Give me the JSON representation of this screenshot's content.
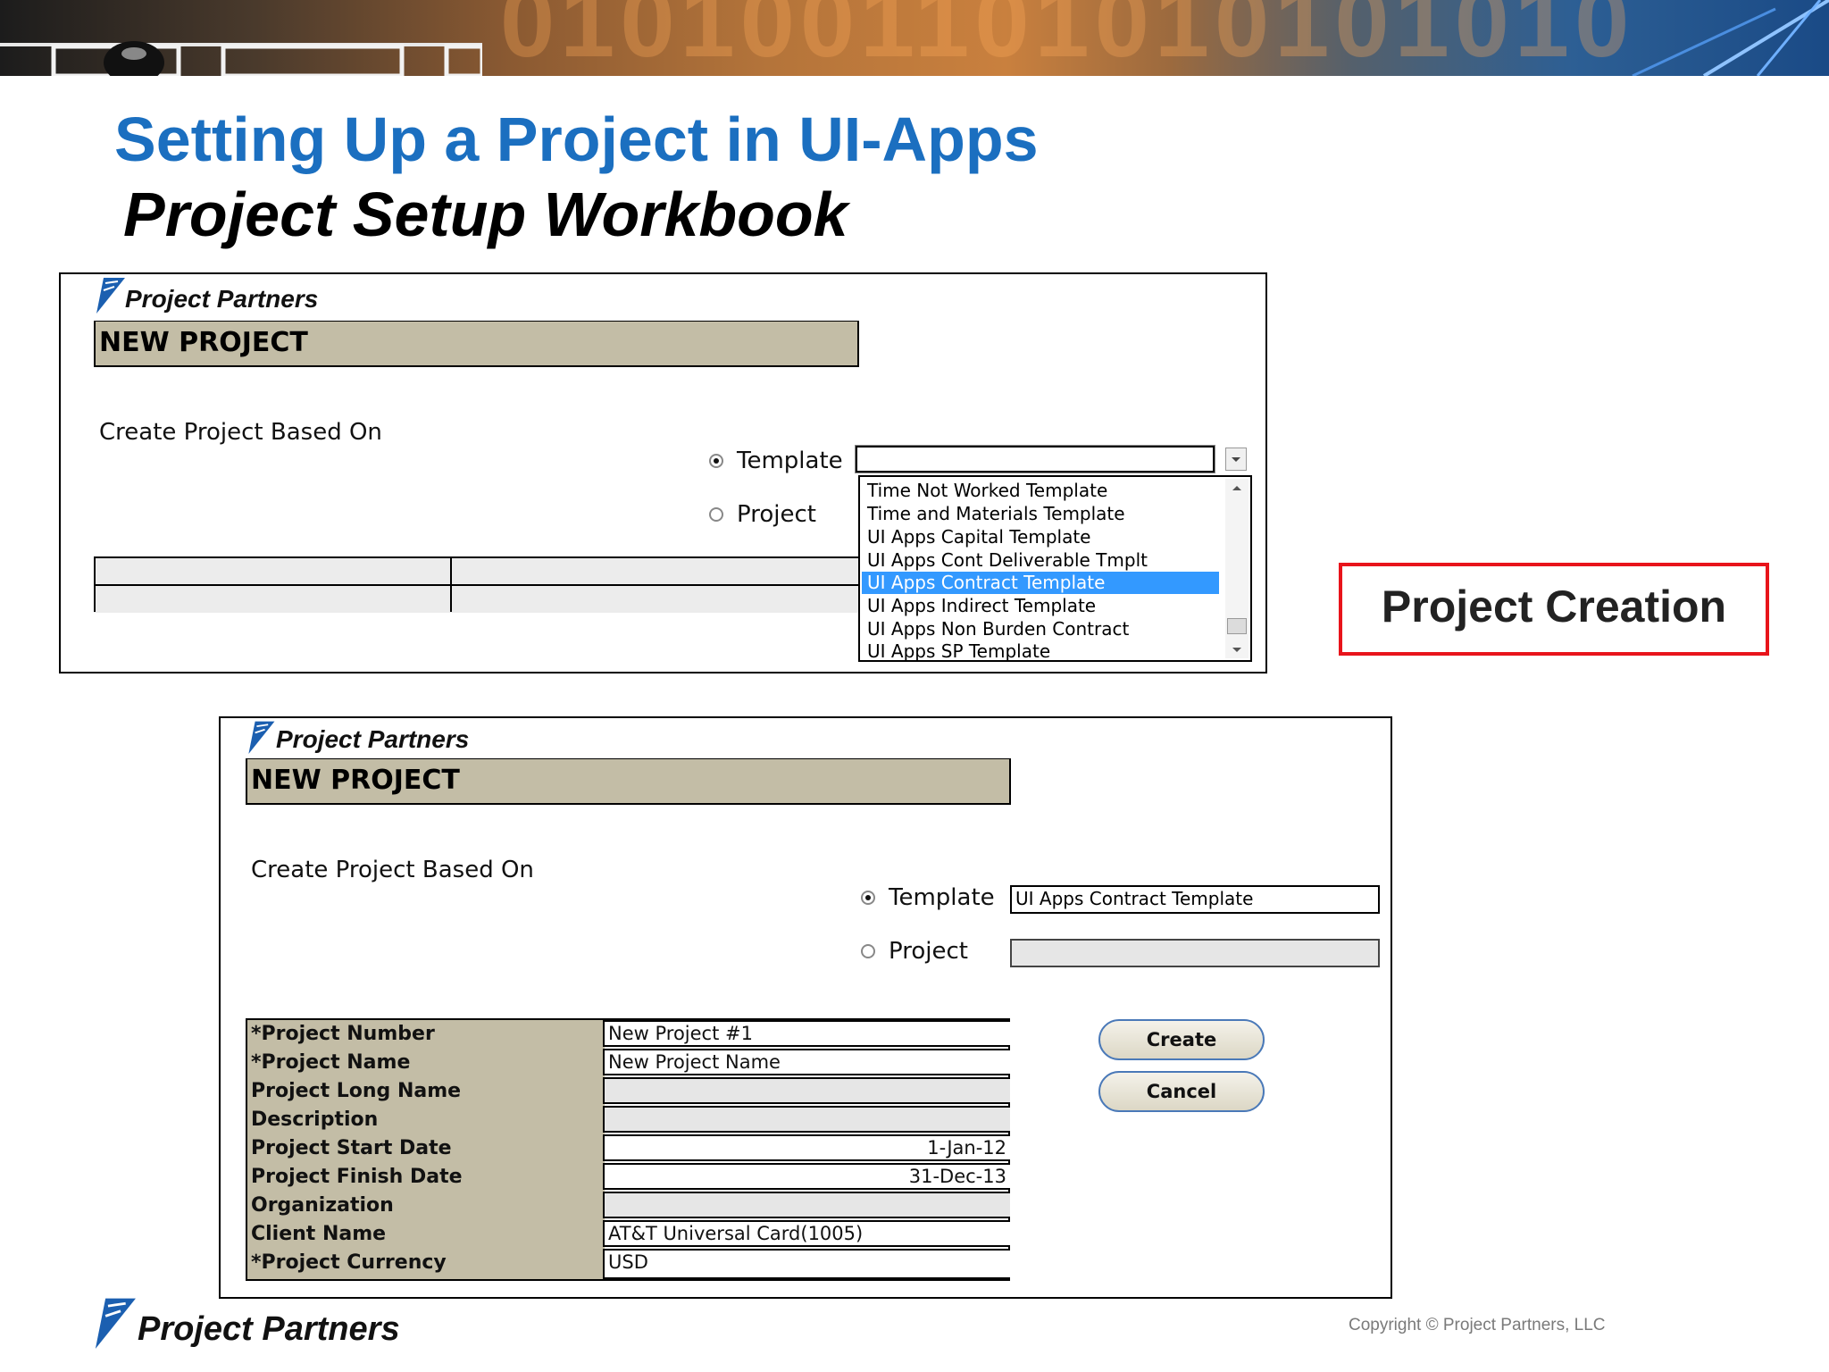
{
  "slide": {
    "title": "Setting Up a Project in UI-Apps",
    "subtitle": "Project Setup Workbook",
    "callout": "Project Creation",
    "copyright": "Copyright © Project Partners, LLC",
    "brand": "Project Partners"
  },
  "panel_top": {
    "logo": "Project Partners",
    "header": "NEW PROJECT",
    "create_label": "Create Project Based On",
    "radio_template": "Template",
    "radio_project": "Project",
    "template_selected": true,
    "dropdown_value": "",
    "dropdown_options": [
      "Time Not Worked Template",
      "Time and Materials Template",
      "UI Apps Capital Template",
      "UI Apps Cont Deliverable Tmplt",
      "UI Apps Contract Template",
      "UI Apps Indirect Template",
      "UI Apps Non Burden Contract",
      "UI Apps SP Template"
    ],
    "highlighted_option": "UI Apps Contract Template"
  },
  "panel_bottom": {
    "logo": "Project Partners",
    "header": "NEW PROJECT",
    "create_label": "Create Project Based On",
    "radio_template": "Template",
    "radio_project": "Project",
    "template_selected": true,
    "template_value": "UI Apps Contract Template",
    "project_value": "",
    "fields": [
      {
        "label": "*Project Number",
        "value": "New Project #1"
      },
      {
        "label": "*Project Name",
        "value": "New Project Name"
      },
      {
        "label": "Project Long Name",
        "value": ""
      },
      {
        "label": "Description",
        "value": ""
      },
      {
        "label": "Project Start Date",
        "value": "1-Jan-12"
      },
      {
        "label": "Project Finish Date",
        "value": "31-Dec-13"
      },
      {
        "label": "Organization",
        "value": ""
      },
      {
        "label": "Client Name",
        "value": "AT&T Universal Card(1005)"
      },
      {
        "label": "*Project Currency",
        "value": "USD"
      }
    ],
    "buttons": {
      "create": "Create",
      "cancel": "Cancel"
    }
  },
  "colors": {
    "title_blue": "#1b6fc0",
    "header_tan": "#c3bda6",
    "selection_blue": "#3399ff",
    "callout_red": "#e8141b"
  }
}
